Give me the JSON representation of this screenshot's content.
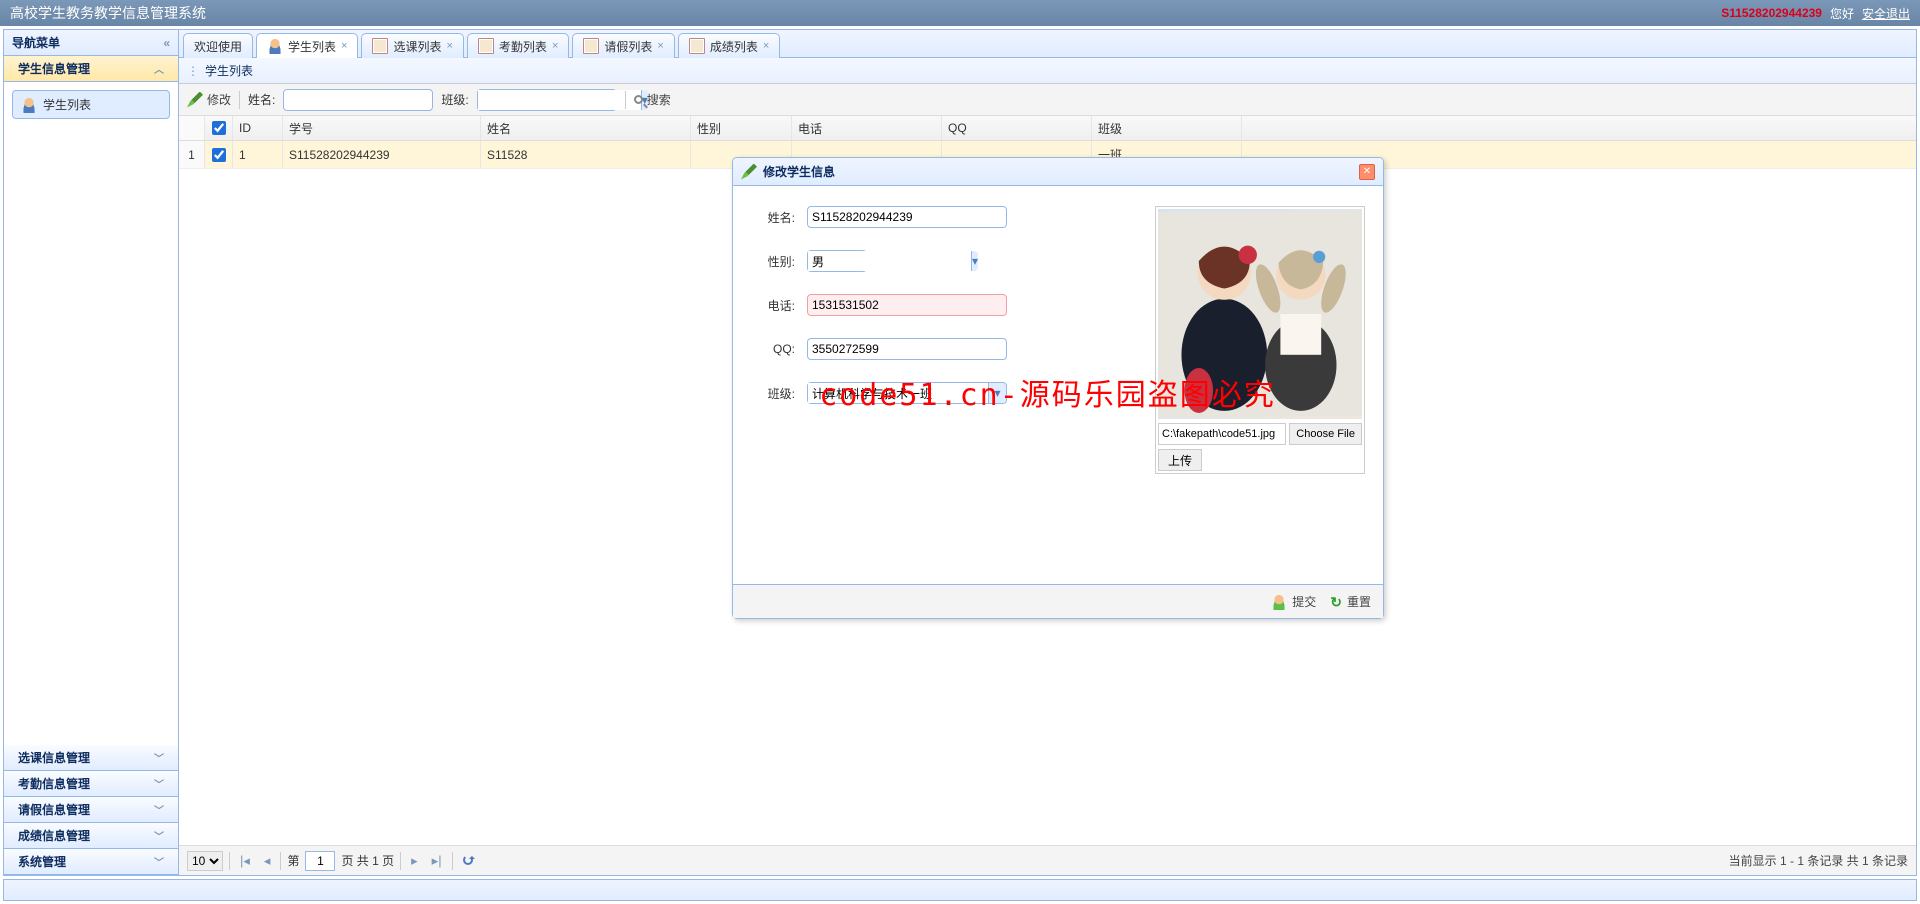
{
  "header": {
    "title": "高校学生教务教学信息管理系统",
    "user": "S11528202944239",
    "greet": "您好",
    "logout": "安全退出"
  },
  "sidebar": {
    "title": "导航菜单",
    "sections": [
      {
        "label": "学生信息管理",
        "open": true
      },
      {
        "label": "选课信息管理"
      },
      {
        "label": "考勤信息管理"
      },
      {
        "label": "请假信息管理"
      },
      {
        "label": "成绩信息管理"
      },
      {
        "label": "系统管理"
      }
    ],
    "leaf": "学生列表"
  },
  "tabs": [
    {
      "label": "欢迎使用",
      "closable": false
    },
    {
      "label": "学生列表",
      "closable": true,
      "active": true,
      "icon": "user"
    },
    {
      "label": "选课列表",
      "closable": true,
      "icon": "book"
    },
    {
      "label": "考勤列表",
      "closable": true,
      "icon": "book"
    },
    {
      "label": "请假列表",
      "closable": true,
      "icon": "book"
    },
    {
      "label": "成绩列表",
      "closable": true,
      "icon": "book"
    }
  ],
  "subpanel": {
    "title": "学生列表"
  },
  "toolbar": {
    "edit_label": "修改",
    "name_label": "姓名:",
    "class_label": "班级:",
    "search_label": "搜索"
  },
  "grid": {
    "columns": {
      "id": "ID",
      "sno": "学号",
      "name": "姓名",
      "sex": "性别",
      "tel": "电话",
      "qq": "QQ",
      "class": "班级"
    },
    "rows": [
      {
        "idx": "1",
        "checked": true,
        "id": "1",
        "sno": "S11528202944239",
        "name": "S11528",
        "class_suffix": "一班"
      }
    ]
  },
  "pager": {
    "page_size": "10",
    "page_prefix": "第",
    "page_value": "1",
    "page_suffix": "页 共 1 页",
    "info": "当前显示 1 - 1 条记录 共 1 条记录"
  },
  "dialog": {
    "title": "修改学生信息",
    "fields": {
      "name_label": "姓名:",
      "name_value": "S11528202944239",
      "sex_label": "性别:",
      "sex_value": "男",
      "tel_label": "电话:",
      "tel_value": "1531531502",
      "qq_label": "QQ:",
      "qq_value": "3550272599",
      "class_label": "班级:",
      "class_value": "计算机科学与技术一班"
    },
    "file": {
      "path": "C:\\fakepath\\code51.jpg",
      "choose": "Choose File",
      "upload": "上传"
    },
    "buttons": {
      "submit": "提交",
      "reset": "重置"
    }
  },
  "watermark": "code51.cn-源码乐园盗图必究"
}
